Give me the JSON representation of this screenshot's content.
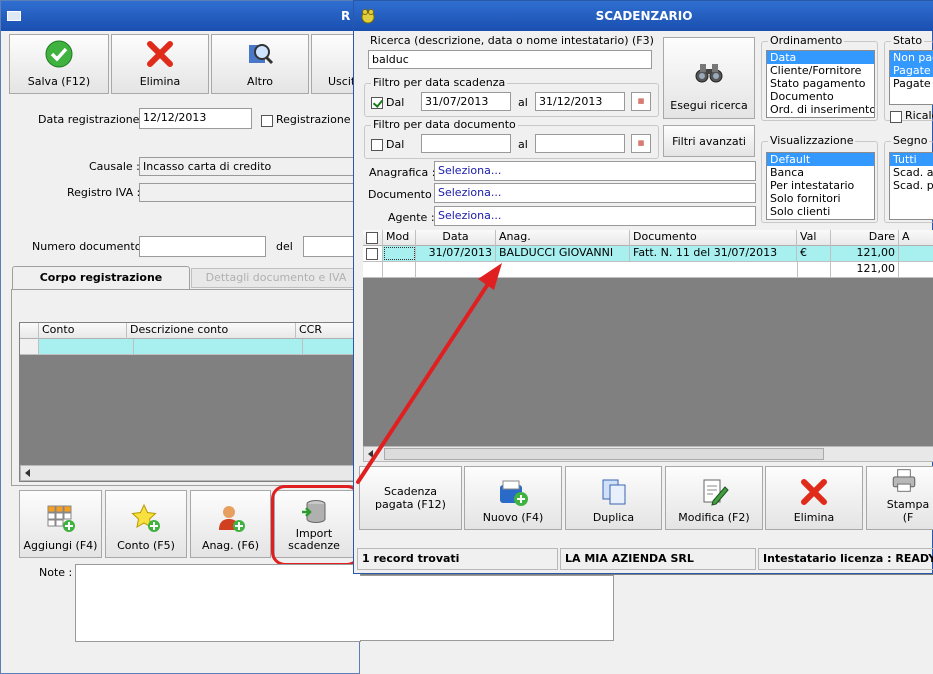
{
  "back_window": {
    "title": "R",
    "toolbar": {
      "save": "Salva (F12)",
      "delete": "Elimina",
      "other": "Altro",
      "exit": "Uscit"
    },
    "date_label": "Data registrazione :",
    "date_value": "12/12/2013",
    "reg_check_label": "Registrazione da",
    "causale_label": "Causale :",
    "causale_value": "Incasso carta di credito",
    "registro_label": "Registro IVA :",
    "numdoc_label": "Numero documento :",
    "del_label": "del",
    "tabs": {
      "corpo": "Corpo registrazione",
      "dettagli": "Dettagli documento e IVA"
    },
    "grid_headers": {
      "conto": "Conto",
      "descrizione": "Descrizione conto",
      "ccr": "CCR"
    },
    "buttons": {
      "aggiungi": "Aggiungi (F4)",
      "conto": "Conto (F5)",
      "anag": "Anag. (F6)",
      "import": "Import scadenze"
    },
    "note_label": "Note :"
  },
  "scad": {
    "title": "SCADENZARIO",
    "search_label": "Ricerca (descrizione, data o nome intestatario) (F3)",
    "search_value": "balduc",
    "exec_search": "Esegui ricerca",
    "adv_filters": "Filtri avanzati",
    "filter_scad_title": "Filtro per data scadenza",
    "filter_scad_dal": "Dal",
    "filter_scad_from": "31/07/2013",
    "filter_scad_al": "al",
    "filter_scad_to": "31/12/2013",
    "filter_doc_title": "Filtro per data documento",
    "filter_doc_dal": "Dal",
    "filter_doc_al": "al",
    "anagrafica_label": "Anagrafica :",
    "anagrafica_value": "Seleziona...",
    "documento_label": "Documento :",
    "documento_value": "Seleziona...",
    "agente_label": "Agente :",
    "agente_value": "Seleziona...",
    "ordinamento_title": "Ordinamento",
    "ordinamento": [
      "Data",
      "Cliente/Fornitore",
      "Stato pagamento",
      "Documento",
      "Ord. di inserimento"
    ],
    "visual_title": "Visualizzazione",
    "visual": [
      "Default",
      "Banca",
      "Per intestatario",
      "Solo fornitori",
      "Solo clienti"
    ],
    "stato_title": "Stato",
    "stato": [
      "Non paga",
      "Pagate p",
      "Pagate"
    ],
    "ricalc": "Ricalco",
    "segno_title": "Segno",
    "segno": [
      "Tutti",
      "Scad. att",
      "Scad. pa"
    ],
    "grid_headers": {
      "mod": "Mod",
      "data": "Data",
      "anag": "Anag.",
      "documento": "Documento",
      "val": "Val",
      "dare": "Dare",
      "a": "A"
    },
    "row": {
      "data": "31/07/2013",
      "anag": "BALDUCCI GIOVANNI",
      "documento": "Fatt. N. 11 del 31/07/2013",
      "val": "€",
      "dare": "121,00"
    },
    "total": "121,00",
    "buttons": {
      "pagata": "Scadenza pagata (F12)",
      "nuovo": "Nuovo (F4)",
      "duplica": "Duplica",
      "modifica": "Modifica (F2)",
      "elimina": "Elimina",
      "stampa": "Stampa (F"
    },
    "status": {
      "records": "1 record trovati",
      "company": "LA MIA AZIENDA SRL",
      "license": "Intestatario licenza : READY TE"
    }
  }
}
